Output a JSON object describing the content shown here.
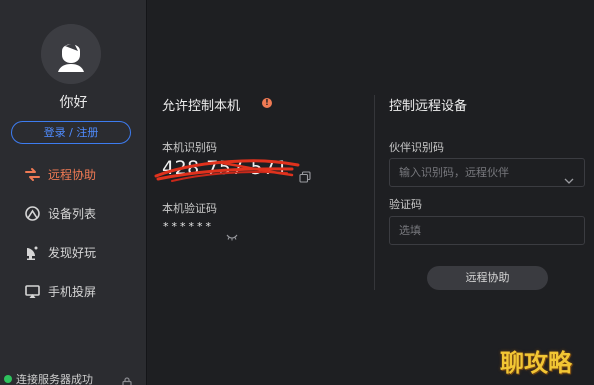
{
  "sidebar": {
    "greeting": "你好",
    "login_label": "登录 / 注册",
    "items": [
      {
        "label": "远程协助",
        "icon": "remote-assist-icon",
        "active": true
      },
      {
        "label": "设备列表",
        "icon": "device-list-icon",
        "active": false
      },
      {
        "label": "发现好玩",
        "icon": "discover-icon",
        "active": false
      },
      {
        "label": "手机投屏",
        "icon": "screen-cast-icon",
        "active": false
      }
    ],
    "status_text": "连接服务器成功"
  },
  "allow_panel": {
    "title": "允许控制本机",
    "device_id_label": "本机识别码",
    "device_id": "428 757 571",
    "code_label": "本机验证码",
    "code_mask": "******"
  },
  "remote_panel": {
    "title": "控制远程设备",
    "partner_label": "伙伴识别码",
    "partner_placeholder": "输入识别码，远程伙伴",
    "code_label": "验证码",
    "code_placeholder": "选填",
    "connect_label": "远程协助"
  },
  "watermark": "聊攻略",
  "colors": {
    "accent": "#f07a54",
    "primary": "#3d7cf0",
    "status_ok": "#2ec25d",
    "watermark": "#f2c634"
  }
}
